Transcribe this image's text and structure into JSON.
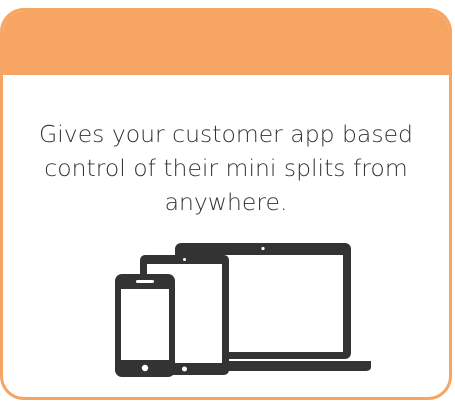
{
  "card": {
    "description": "Gives your customer app based control of their mini splits from anywhere.",
    "accent_color": "#f7a563",
    "text_color": "#333333",
    "illustration": {
      "icon_name": "devices-icon",
      "color": "#333333"
    }
  }
}
